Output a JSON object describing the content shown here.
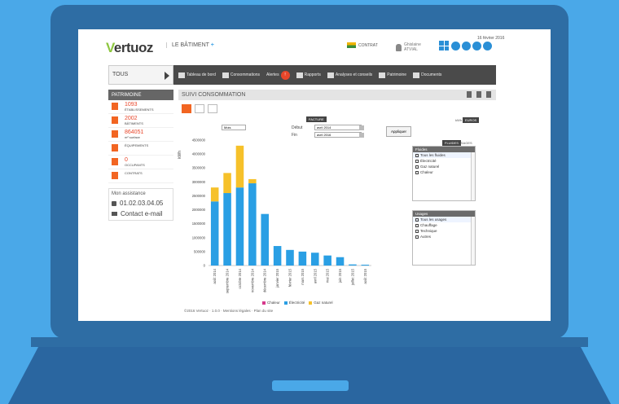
{
  "header": {
    "logo_accent": "V",
    "logo_rest": "ertuoz",
    "building_label": "LE BÂTIMENT",
    "building_plus": "+",
    "contract_label": "CONTRAT",
    "user_line1": "Ghislaine",
    "user_line2": "ATVIAL",
    "date": "16 février 2016"
  },
  "nav": {
    "scope": "TOUS",
    "items": [
      {
        "label": "Tableau de bord",
        "icon": "dashboard-icon"
      },
      {
        "label": "Consommations",
        "icon": "bar-chart-icon"
      },
      {
        "label": "Alertes",
        "icon": "alert-icon",
        "badge": "!"
      },
      {
        "label": "Rapports",
        "icon": "report-icon"
      },
      {
        "label": "Analyses et conseils",
        "icon": "analysis-icon"
      },
      {
        "label": "Patrimoine",
        "icon": "building-icon"
      },
      {
        "label": "Documents",
        "icon": "document-icon"
      }
    ]
  },
  "sidebar": {
    "title": "PATRIMOINE",
    "stats": [
      {
        "value": "1093",
        "label": "ÉTABLISSEMENTS",
        "icon": "building-icon"
      },
      {
        "value": "2002",
        "label": "BÂTIMENTS",
        "icon": "tower-icon"
      },
      {
        "value": "864051",
        "label": "m² surface",
        "icon": "area-icon"
      },
      {
        "value": "",
        "label": "ÉQUIPEMENTS",
        "icon": "equipment-icon"
      },
      {
        "value": "0",
        "label": "OCCUPANTS",
        "icon": "people-icon"
      },
      {
        "value": "",
        "label": "CONTRATS",
        "icon": "contract-icon"
      }
    ],
    "assistance_title": "Mon assistance",
    "phone": "01.02.03.04.05",
    "email": "Contact e-mail"
  },
  "main": {
    "title": "SUIVI CONSOMMATION",
    "period_select": "Mois",
    "facture_tab": "FACTURE",
    "from_label": "Début",
    "from_value": "avril 2014",
    "to_label": "Fin",
    "to_value": "avril 2016",
    "apply": "Appliquer",
    "unit_toggle_1": "kWh",
    "unit_toggle_2": "EUROS",
    "mode_toggle_1": "FLUIDES",
    "mode_toggle_2": "USAGES",
    "fluids_title": "Fluides",
    "fluids": [
      "Tous les fluides",
      "Électricité",
      "Gaz naturel",
      "Chaleur"
    ],
    "usages_title": "Usages",
    "usages": [
      "Tous les usages",
      "Chauffage",
      "Technique",
      "Autres"
    ],
    "footer": "©2016 Vertuoz · 1.0.0 · Mentions légales · Plan du site"
  },
  "colors": {
    "accent_green": "#8dc63f",
    "alert_orange": "#f26522",
    "electricity": "#2a9fe4",
    "gas": "#f6c12a",
    "heat": "#d6398b",
    "menu_dark": "#4a4a4a"
  },
  "chart_data": {
    "type": "bar",
    "stacked": true,
    "ylabel": "kWh",
    "ylim": [
      0,
      4500000
    ],
    "yticks": [
      0,
      500000,
      1000000,
      1500000,
      2000000,
      2500000,
      3000000,
      3500000,
      4000000,
      4500000
    ],
    "categories": [
      "août 2014",
      "septembre 2014",
      "octobre 2014",
      "novembre 2014",
      "décembre 2014",
      "janvier 2015",
      "février 2015",
      "mars 2015",
      "avril 2015",
      "mai 2015",
      "juin 2015",
      "juillet 2015",
      "août 2015"
    ],
    "series": [
      {
        "name": "Chaleur",
        "color": "#d6398b",
        "values": [
          0,
          0,
          0,
          0,
          0,
          0,
          0,
          0,
          0,
          0,
          0,
          0,
          0
        ]
      },
      {
        "name": "Électricité",
        "color": "#2a9fe4",
        "values": [
          2300000,
          2600000,
          2800000,
          2950000,
          1850000,
          700000,
          560000,
          500000,
          460000,
          360000,
          300000,
          40000,
          30000
        ]
      },
      {
        "name": "Gaz naturel",
        "color": "#f6c12a",
        "values": [
          500000,
          720000,
          1500000,
          150000,
          0,
          0,
          0,
          0,
          0,
          0,
          0,
          0,
          0
        ]
      }
    ]
  }
}
